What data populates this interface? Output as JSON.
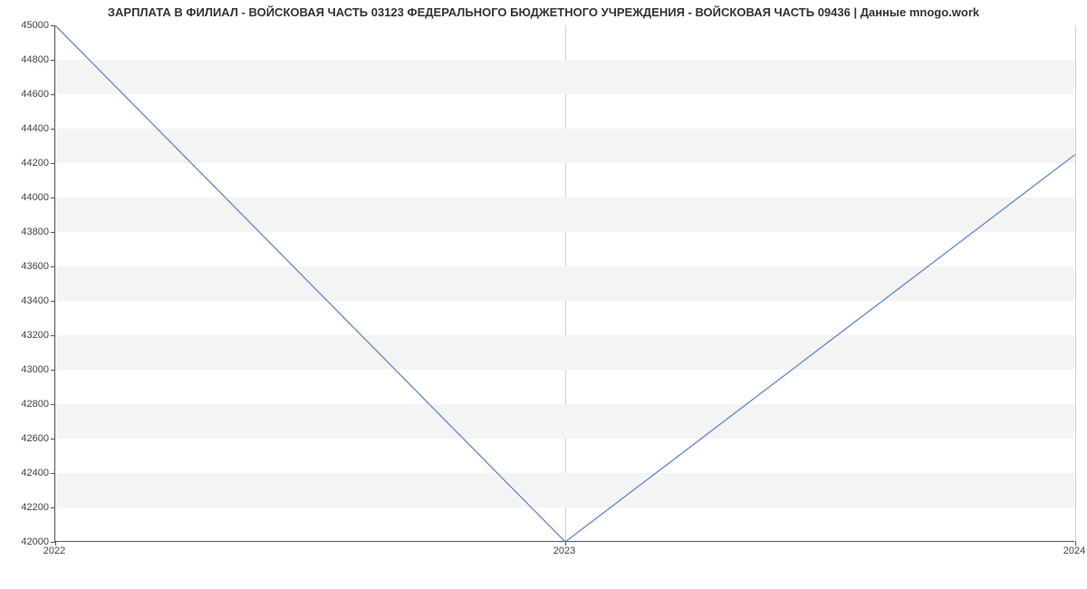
{
  "chart_data": {
    "type": "line",
    "title": "ЗАРПЛАТА В ФИЛИАЛ - ВОЙСКОВАЯ ЧАСТЬ 03123 ФЕДЕРАЛЬНОГО БЮДЖЕТНОГО УЧРЕЖДЕНИЯ - ВОЙСКОВАЯ ЧАСТЬ 09436 | Данные mnogo.work",
    "x": [
      2022,
      2023,
      2024
    ],
    "values": [
      45000,
      42000,
      44250
    ],
    "xlabel": "",
    "ylabel": "",
    "xlim": [
      2022,
      2024
    ],
    "ylim": [
      42000,
      45000
    ],
    "y_ticks": [
      42000,
      42200,
      42400,
      42600,
      42800,
      43000,
      43200,
      43400,
      43600,
      43800,
      44000,
      44200,
      44400,
      44600,
      44800,
      45000
    ],
    "x_ticks": [
      2022,
      2023,
      2024
    ],
    "line_color": "#6b8ecf"
  }
}
